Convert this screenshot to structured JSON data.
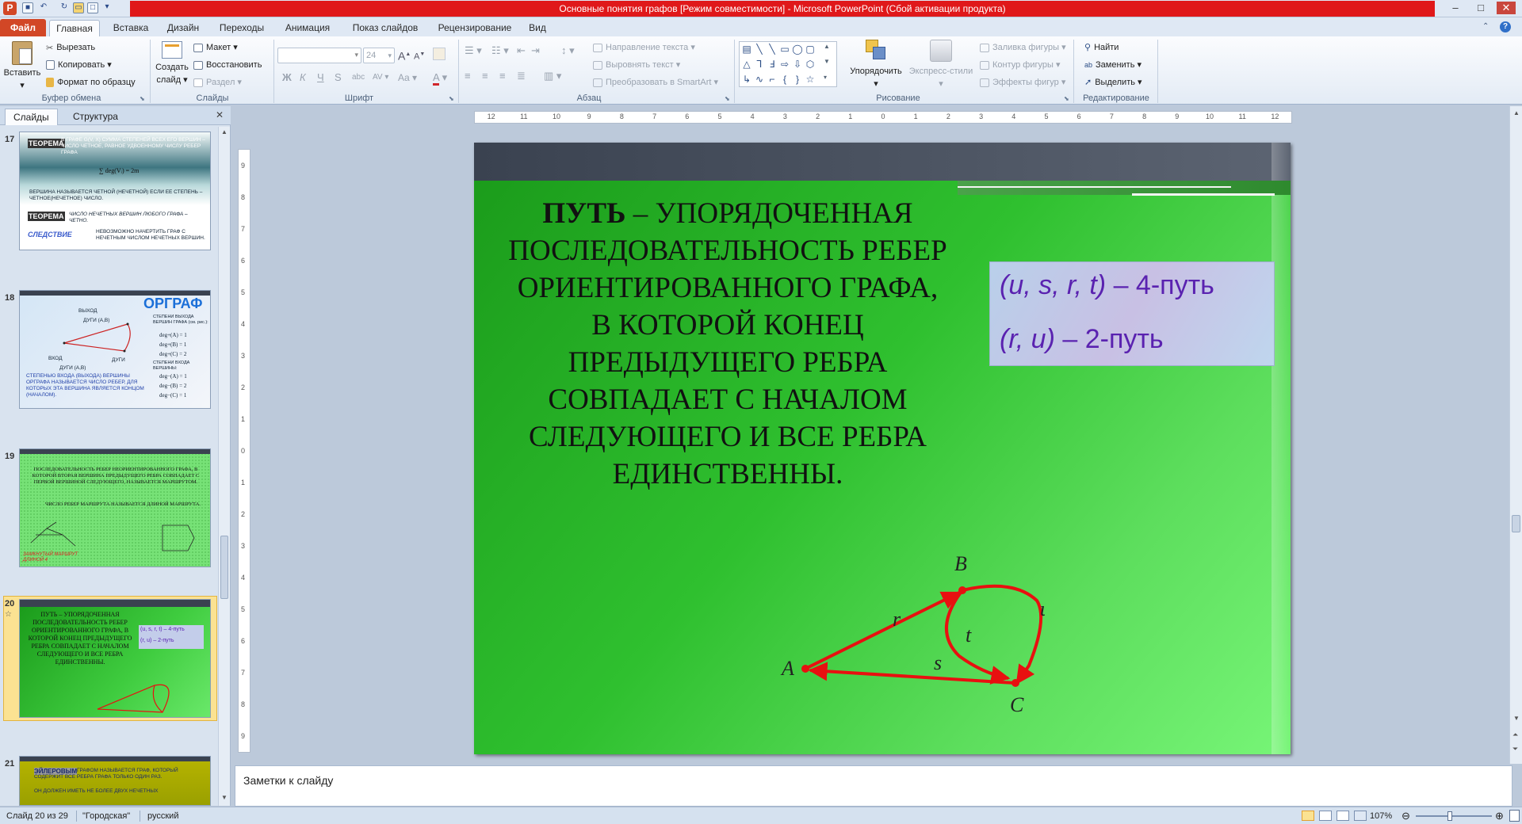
{
  "window": {
    "title": "Основные понятия графов [Режим совместимости]  -  Microsoft PowerPoint (Сбой активации продукта)",
    "app_icon": "powerpoint-icon",
    "accent_red": "#e0181a"
  },
  "tabs": [
    "Файл",
    "Главная",
    "Вставка",
    "Дизайн",
    "Переходы",
    "Анимация",
    "Показ слайдов",
    "Рецензирование",
    "Вид"
  ],
  "ribbon": {
    "clipboard": {
      "paste": "Вставить",
      "cut": "Вырезать",
      "copy": "Копировать",
      "format_painter": "Формат по образцу",
      "label": "Буфер обмена"
    },
    "slides": {
      "new_slide_line1": "Создать",
      "new_slide_line2": "слайд",
      "layout": "Макет",
      "reset": "Восстановить",
      "section": "Раздел",
      "label": "Слайды"
    },
    "font": {
      "size": "24",
      "label": "Шрифт",
      "bold": "Ж",
      "italic": "К",
      "underline": "Ч",
      "strike": "S",
      "shadow": "abc",
      "spacing": "AV",
      "case": "Aa",
      "color": "A",
      "grow": "A",
      "shrink": "A"
    },
    "paragraph": {
      "text_direction": "Направление текста",
      "align_text": "Выровнять текст",
      "smartart": "Преобразовать в SmartArt",
      "label": "Абзац"
    },
    "drawing": {
      "arrange": "Упорядочить",
      "quick_styles": "Экспресс-стили",
      "fill": "Заливка фигуры",
      "outline": "Контур фигуры",
      "effects": "Эффекты фигур",
      "label": "Рисование"
    },
    "editing": {
      "find": "Найти",
      "replace": "Заменить",
      "select": "Выделить",
      "label": "Редактирование"
    }
  },
  "left_pane": {
    "tab_slides": "Слайды",
    "tab_outline": "Структура",
    "thumbnails": [
      {
        "num": "17",
        "heading": "ТЕОРЕМА",
        "text1": "В ГРАФЕ G(V, X) СУММА СТЕПЕНЕЙ ВСЕХ ЕГО ВЕРШИН – ЧИСЛО ЧЕТНОЕ, РАВНОЕ УДВОЕННОМУ ЧИСЛУ РЕБЕР ГРАФА",
        "formula": "∑ deg(Vᵢ) = 2m",
        "text2": "ВЕРШИНА НАЗЫВАЕТСЯ ЧЕТНОЙ (НЕЧЕТНОЙ) ЕСЛИ ЕЕ СТЕПЕНЬ – ЧЕТНОЕ(НЕЧЕТНОЕ) ЧИСЛО.",
        "heading2": "ТЕОРЕМА",
        "text3": "ЧИСЛО НЕЧЕТНЫХ ВЕРШИН ЛЮБОГО ГРАФА – ЧЕТНО.",
        "heading3": "СЛЕДСТВИЕ",
        "text4": "НЕВОЗМОЖНО НАЧЕРТИТЬ ГРАФ С НЕЧЕТНЫМ ЧИСЛОМ НЕЧЕТНЫХ ВЕРШИН."
      },
      {
        "num": "18",
        "heading": "ОРГРАФ",
        "out_label": "ВЫХОД",
        "out_arcs": "ДУГИ (A,B)",
        "in_label": "ВХОД",
        "in_arcs": "ДУГИ (A,B)",
        "arcs": "ДУГИ",
        "deg_out_title": "СТЕПЕНИ ВЫХОДА ВЕРШИН ГРАФА (см. рис.):",
        "deg_out_1": "deg+(A) = 1",
        "deg_out_2": "deg+(B) = 1",
        "deg_out_3": "deg+(C) = 2",
        "deg_in_title": "СТЕПЕНИ ВХОДА ВЕРШИНЫ:",
        "deg_in_1": "deg−(A) = 1",
        "deg_in_2": "deg−(B) = 2",
        "deg_in_3": "deg−(C) = 1",
        "def_text": "СТЕПЕНЬЮ ВХОДА (ВЫХОДА) ВЕРШИНЫ ОРГРАФА НАЗЫВАЕТСЯ ЧИСЛО РЕБЕР, ДЛЯ КОТОРЫХ ЭТА ВЕРШИНА ЯВЛЯЕТСЯ КОНЦОМ (НАЧАЛОМ)."
      },
      {
        "num": "19",
        "text1": "ПОСЛЕДОВАТЕЛЬНОСТЬ РЕБЕР НЕОРИЕНТИРОВАННОГО ГРАФА, В КОТОРОЙ ВТОРАЯ ВЕРШИНА ПРЕДЫДУЩЕГО РЕБРА СОВПАДАЕТ С ПЕРВОЙ ВЕРШИНОЙ СЛЕДУЮЩЕГО, НАЗЫВАЕТСЯ МАРШРУТОМ.",
        "text2": "ЧИСЛО РЕБЕР МАРШРУТА НАЗЫВАЕТСЯ ДЛИНОЙ МАРШРУТА.",
        "red_note": "ЗАМКНУТЫЙ МАРШРУТ ДЛИНОЙ 4"
      },
      {
        "num": "20",
        "text": "ПУТЬ – УПОРЯДОЧЕННАЯ ПОСЛЕДОВАТЕЛЬНОСТЬ РЕБЕР ОРИЕНТИРОВАННОГО ГРАФА, В КОТОРОЙ КОНЕЦ ПРЕДЫДУЩЕГО РЕБРА СОВПАДАЕТ С НАЧАЛОМ СЛЕДУЮЩЕГО И ВСЕ РЕБРА ЕДИНСТВЕННЫ.",
        "box1": "(u, s, r, t) – 4-путь",
        "box2": "(r, u) – 2-путь",
        "star": "☆"
      },
      {
        "num": "21",
        "heading": "ЭЙЛЕРОВЫМ",
        "text1": "ГРАФОМ НАЗЫВАЕТСЯ ГРАФ, КОТОРЫЙ СОДЕРЖИТ ВСЕ РЕБРА ГРАФА ТОЛЬКО ОДИН РАЗ.",
        "text2": "ОН ДОЛЖЕН ИМЕТЬ НЕ БОЛЕЕ ДВУХ НЕЧЕТНЫХ"
      }
    ]
  },
  "ruler": {
    "h_ticks": [
      "12",
      "11",
      "10",
      "9",
      "8",
      "7",
      "6",
      "5",
      "4",
      "3",
      "2",
      "1",
      "0",
      "1",
      "2",
      "3",
      "4",
      "5",
      "6",
      "7",
      "8",
      "9",
      "10",
      "11",
      "12"
    ],
    "v_ticks": [
      "9",
      "8",
      "7",
      "6",
      "5",
      "4",
      "3",
      "2",
      "1",
      "0",
      "1",
      "2",
      "3",
      "4",
      "5",
      "6",
      "7",
      "8",
      "9"
    ]
  },
  "slide": {
    "title_bold": "ПУТЬ",
    "title_rest": " – УПОРЯДОЧЕННАЯ ПОСЛЕДОВАТЕЛЬНОСТЬ РЕБЕР ОРИЕНТИРОВАННОГО ГРАФА, В КОТОРОЙ КОНЕЦ ПРЕДЫДУЩЕГО РЕБРА СОВПАДАЕТ С НАЧАЛОМ СЛЕДУЮЩЕГО И ВСЕ РЕБРА ЕДИНСТВЕННЫ.",
    "path1_italic": "(u, s, r, t)",
    "path1_rest": " – 4-путь",
    "path2_italic": "(r, u)",
    "path2_rest": " – 2-путь",
    "graph": {
      "node_a": "A",
      "node_b": "B",
      "node_c": "C",
      "edge_r": "r",
      "edge_s": "s",
      "edge_t": "t",
      "edge_u": "u",
      "edge_color": "#e81010"
    }
  },
  "notes_placeholder": "Заметки к слайду",
  "status": {
    "slide_info": "Слайд 20 из 29",
    "theme": "\"Городская\"",
    "language": "русский",
    "zoom": "107%"
  }
}
